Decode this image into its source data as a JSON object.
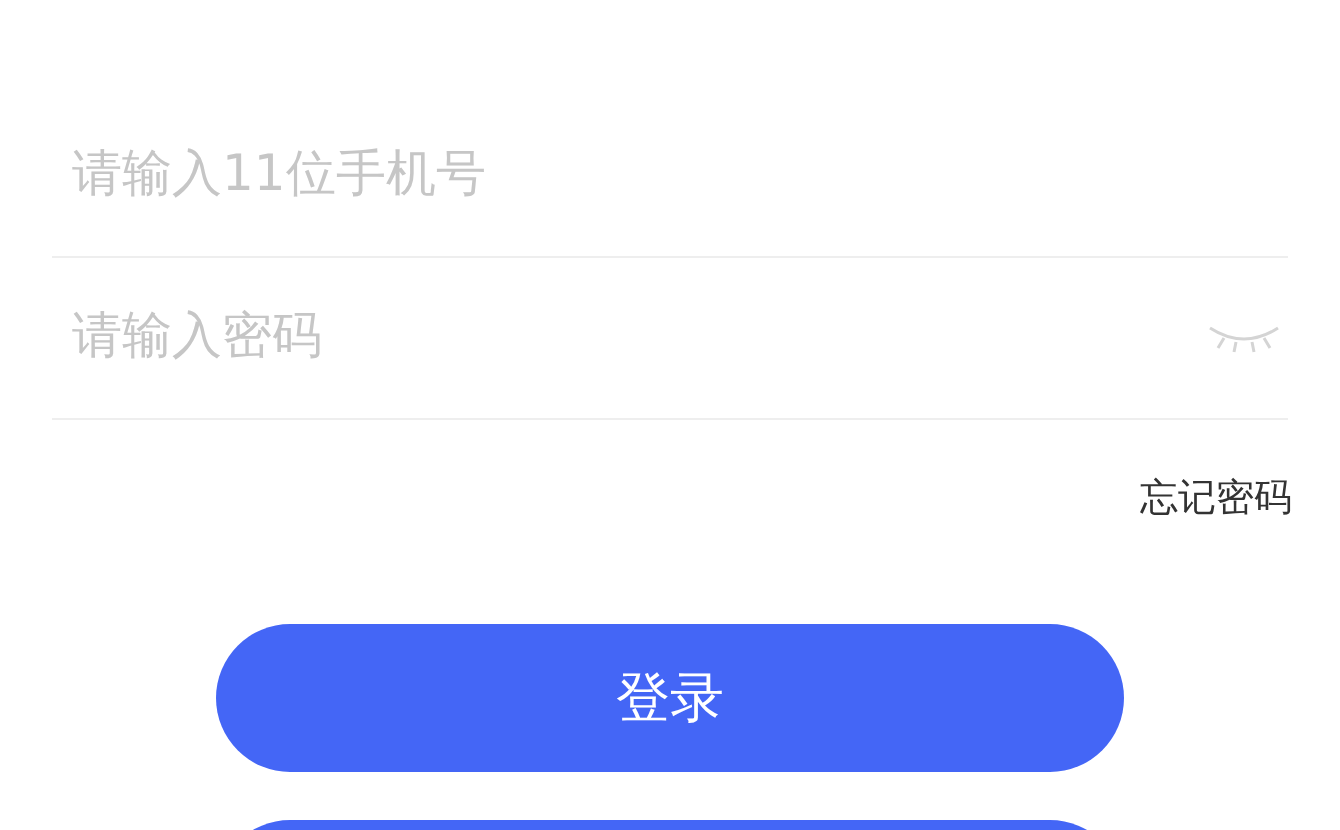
{
  "phone_field": {
    "placeholder": "请输入11位手机号"
  },
  "password_field": {
    "placeholder": "请输入密码",
    "password_visible": false
  },
  "forgot_password_link": "忘记密码",
  "buttons": [
    {
      "kind": "labeled",
      "label": "登录"
    },
    {
      "kind": "cut_off"
    }
  ]
}
